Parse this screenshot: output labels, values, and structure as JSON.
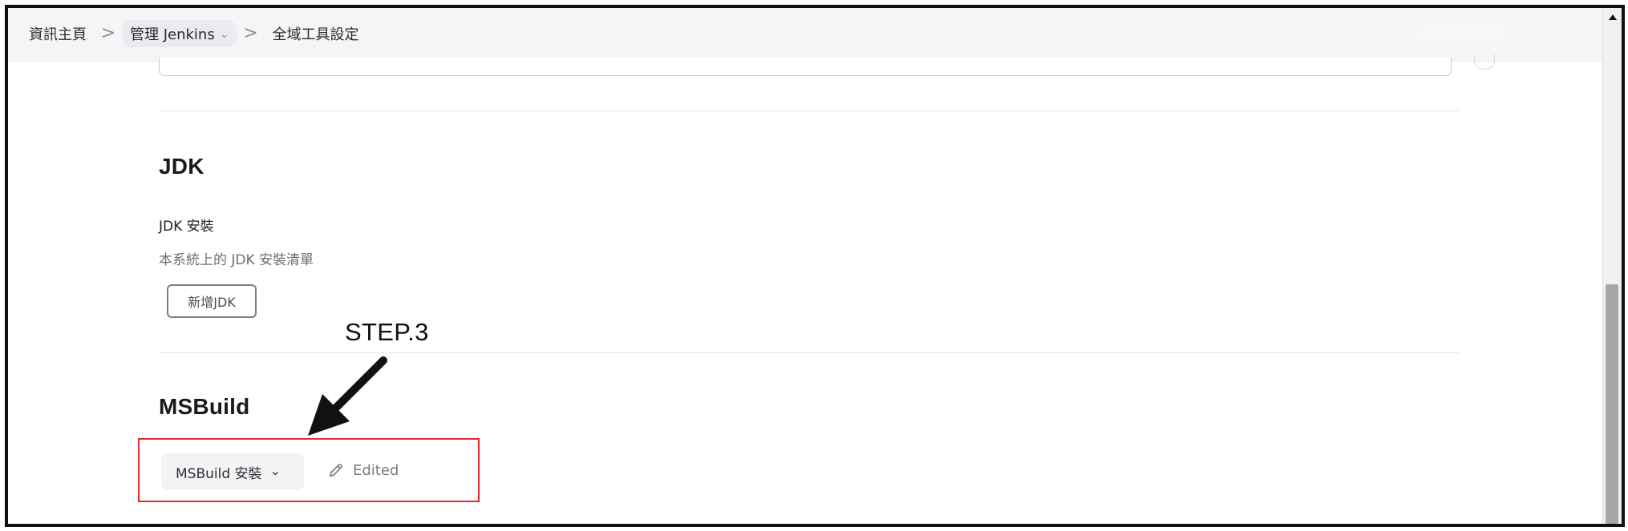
{
  "breadcrumb": {
    "items": [
      {
        "label": "資訊主頁"
      },
      {
        "label": "管理 Jenkins"
      },
      {
        "label": "全域工具設定"
      }
    ],
    "separator": ">",
    "dropdown_caret": "⌄"
  },
  "jdk": {
    "section_title": "JDK",
    "field_title": "JDK 安裝",
    "description": "本系統上的 JDK 安裝清單",
    "add_button_label": "新增JDK"
  },
  "annotation": {
    "step_label": "STEP.3"
  },
  "msbuild": {
    "section_title": "MSBuild",
    "dropdown_label": "MSBuild 安裝",
    "edited_label": "Edited"
  },
  "icons": {
    "breadcrumb_separator_icon": "chevron-right-icon",
    "dropdown_icon": "chevron-down-icon",
    "edit_icon": "pencil-icon",
    "scroll_up_icon": "triangle-up-icon"
  },
  "colors": {
    "highlight_border": "#e22b2b",
    "annotation_arrow": "#111111"
  }
}
